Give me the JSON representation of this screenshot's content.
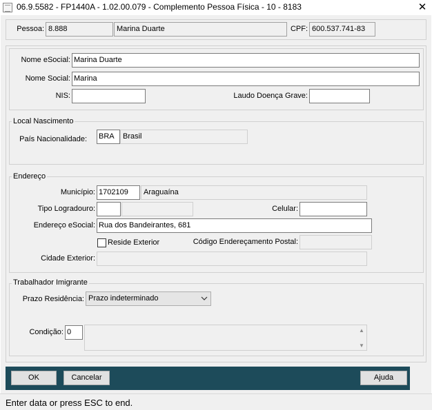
{
  "window": {
    "title": "06.9.5582 - FP1440A - 1.02.00.079 - Complemento Pessoa Física - 10 - 8183",
    "close_glyph": "✕"
  },
  "header": {
    "pessoa_label": "Pessoa:",
    "pessoa_code": "8.888",
    "pessoa_name": "Marina Duarte",
    "cpf_label": "CPF:",
    "cpf_value": "600.537.741-83"
  },
  "identification": {
    "nome_esocial_label": "Nome eSocial:",
    "nome_esocial_value": "Marina Duarte",
    "nome_social_label": "Nome Social:",
    "nome_social_value": "Marina",
    "nis_label": "NIS:",
    "nis_value": "",
    "laudo_label": "Laudo Doença Grave:",
    "laudo_value": ""
  },
  "local_nascimento": {
    "title": "Local Nascimento",
    "pais_label": "País Nacionalidade:",
    "pais_code": "BRA",
    "pais_name": "Brasil"
  },
  "endereco": {
    "title": "Endereço",
    "municipio_label": "Município:",
    "municipio_code": "1702109",
    "municipio_name": "Araguaína",
    "tipo_logradouro_label": "Tipo Logradouro:",
    "tipo_logradouro_code": "",
    "tipo_logradouro_desc": "",
    "celular_label": "Celular:",
    "celular_value": "",
    "endereco_esocial_label": "Endereço eSocial:",
    "endereco_esocial_value": "Rua dos Bandeirantes, 681",
    "reside_exterior_label": "Reside Exterior",
    "reside_exterior_checked": false,
    "cep_label": "Código Endereçamento Postal:",
    "cep_value": "",
    "cidade_exterior_label": "Cidade Exterior:",
    "cidade_exterior_value": ""
  },
  "imigrante": {
    "title": "Trabalhador Imigrante",
    "prazo_label": "Prazo Residência:",
    "prazo_selected": "Prazo indeterminado",
    "condicao_label": "Condição:",
    "condicao_code": "0",
    "condicao_desc": ""
  },
  "buttons": {
    "ok": "OK",
    "cancel": "Cancelar",
    "help": "Ajuda"
  },
  "status_bar": {
    "text": "Enter data or press ESC to end."
  },
  "colors": {
    "button_bar": "#1d4b5a",
    "window_bg": "#f0f0f0"
  }
}
